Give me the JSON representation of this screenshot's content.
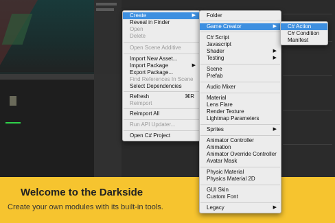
{
  "context_menu": {
    "items": [
      {
        "label": "Create",
        "submenu": true,
        "highlight": true
      },
      {
        "label": "Reveal in Finder"
      },
      {
        "label": "Open",
        "disabled": true
      },
      {
        "label": "Delete",
        "disabled": true
      },
      {
        "label": "Open Scene Additive",
        "disabled": true
      },
      {
        "label": "Import New Asset..."
      },
      {
        "label": "Import Package",
        "submenu": true
      },
      {
        "label": "Export Package..."
      },
      {
        "label": "Find References In Scene",
        "disabled": true
      },
      {
        "label": "Select Dependencies"
      },
      {
        "label": "Refresh",
        "shortcut": "⌘R"
      },
      {
        "label": "Reimport",
        "disabled": true
      },
      {
        "label": "Reimport All"
      },
      {
        "label": "Run API Updater...",
        "disabled": true
      },
      {
        "label": "Open C# Project"
      }
    ]
  },
  "create_menu": {
    "items": [
      {
        "label": "Folder"
      },
      {
        "label": "Game Creator",
        "submenu": true,
        "highlight": true
      },
      {
        "label": "C# Script"
      },
      {
        "label": "Javascript"
      },
      {
        "label": "Shader",
        "submenu": true
      },
      {
        "label": "Testing",
        "submenu": true
      },
      {
        "label": "Scene"
      },
      {
        "label": "Prefab"
      },
      {
        "label": "Audio Mixer"
      },
      {
        "label": "Material"
      },
      {
        "label": "Lens Flare"
      },
      {
        "label": "Render Texture"
      },
      {
        "label": "Lightmap Parameters"
      },
      {
        "label": "Sprites",
        "submenu": true
      },
      {
        "label": "Animator Controller"
      },
      {
        "label": "Animation"
      },
      {
        "label": "Animator Override Controller"
      },
      {
        "label": "Avatar Mask"
      },
      {
        "label": "Physic Material"
      },
      {
        "label": "Physics Material 2D"
      },
      {
        "label": "GUI Skin"
      },
      {
        "label": "Custom Font"
      },
      {
        "label": "Legacy",
        "submenu": true
      }
    ]
  },
  "game_creator_menu": {
    "items": [
      {
        "label": "C# Action",
        "highlight": true
      },
      {
        "label": "C# Condition"
      },
      {
        "label": "Manifest"
      }
    ]
  },
  "banner": {
    "title": "Welcome to the Darkside",
    "subtitle": "Create your own modules with its built-in tools."
  },
  "colors": {
    "highlight": "#3d8fe0",
    "banner": "#f6c42f",
    "menu_bg": "#ececec"
  },
  "icons": {
    "submenu_arrow": "▶"
  }
}
